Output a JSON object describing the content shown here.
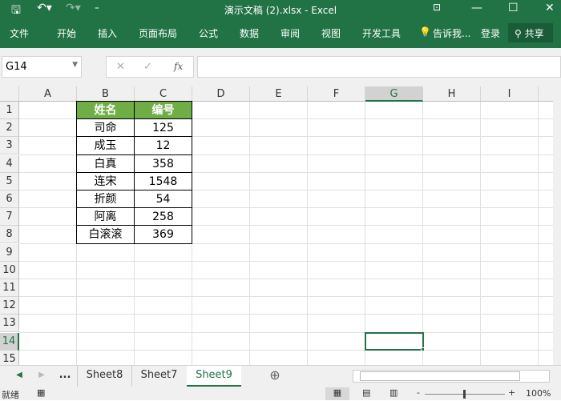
{
  "window": {
    "title": "演示文稿 (2).xlsx - Excel"
  },
  "ribbon": {
    "tabs": [
      "文件",
      "开始",
      "插入",
      "页面布局",
      "公式",
      "数据",
      "审阅",
      "视图",
      "开发工具"
    ],
    "tell_me": "告诉我...",
    "login": "登录",
    "share": "共享"
  },
  "formula_bar": {
    "name_box": "G14",
    "formula": "",
    "fx_label": "fx"
  },
  "columns": [
    "A",
    "B",
    "C",
    "D",
    "E",
    "F",
    "G",
    "H",
    "I"
  ],
  "rows": [
    "1",
    "2",
    "3",
    "4",
    "5",
    "6",
    "7",
    "8",
    "9",
    "10",
    "11",
    "12",
    "13",
    "14",
    "15",
    "16"
  ],
  "selected_cell": "G14",
  "table": {
    "header_color": "#70ad47",
    "headers": [
      "姓名",
      "编号"
    ],
    "rows": [
      [
        "司命",
        "125"
      ],
      [
        "成玉",
        "12"
      ],
      [
        "白真",
        "358"
      ],
      [
        "连宋",
        "1548"
      ],
      [
        "折颜",
        "54"
      ],
      [
        "阿离",
        "258"
      ],
      [
        "白滚滚",
        "369"
      ]
    ]
  },
  "sheets": {
    "ellipsis": "...",
    "tabs": [
      "Sheet8",
      "Sheet7",
      "Sheet9"
    ],
    "active": "Sheet9"
  },
  "status": {
    "ready": "就绪",
    "zoom": "100%"
  },
  "accent": "#217346"
}
